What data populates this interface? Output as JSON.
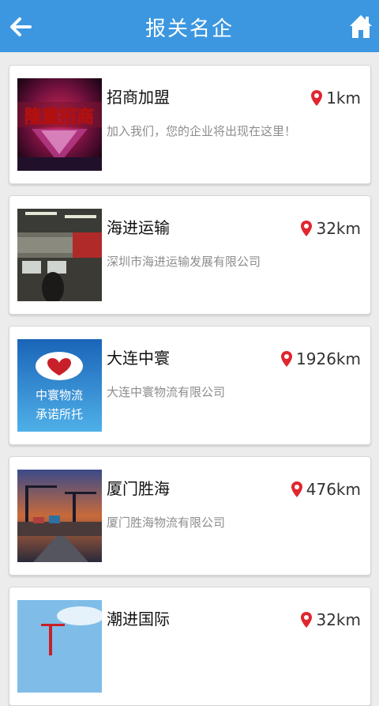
{
  "header": {
    "title": "报关名企",
    "back_icon": "back-arrow-icon",
    "home_icon": "home-icon",
    "color": "#3c97e0"
  },
  "companies": [
    {
      "name": "招商加盟",
      "distance": "1km",
      "desc": "加入我们，您的企业将出现在这里！",
      "thumb_text": "隆重招商"
    },
    {
      "name": "海进运输",
      "distance": "32km",
      "desc": "深圳市海进运输发展有限公司"
    },
    {
      "name": "大连中寰",
      "distance": "1926km",
      "desc": "大连中寰物流有限公司",
      "thumb_text_1": "中寰物流",
      "thumb_text_2": "承诺所托"
    },
    {
      "name": "厦门胜海",
      "distance": "476km",
      "desc": "厦门胜海物流有限公司"
    },
    {
      "name": "潮进国际",
      "distance": "32km",
      "desc": ""
    }
  ],
  "pin_icon": "location-pin-icon",
  "pin_color": "#e0262f"
}
